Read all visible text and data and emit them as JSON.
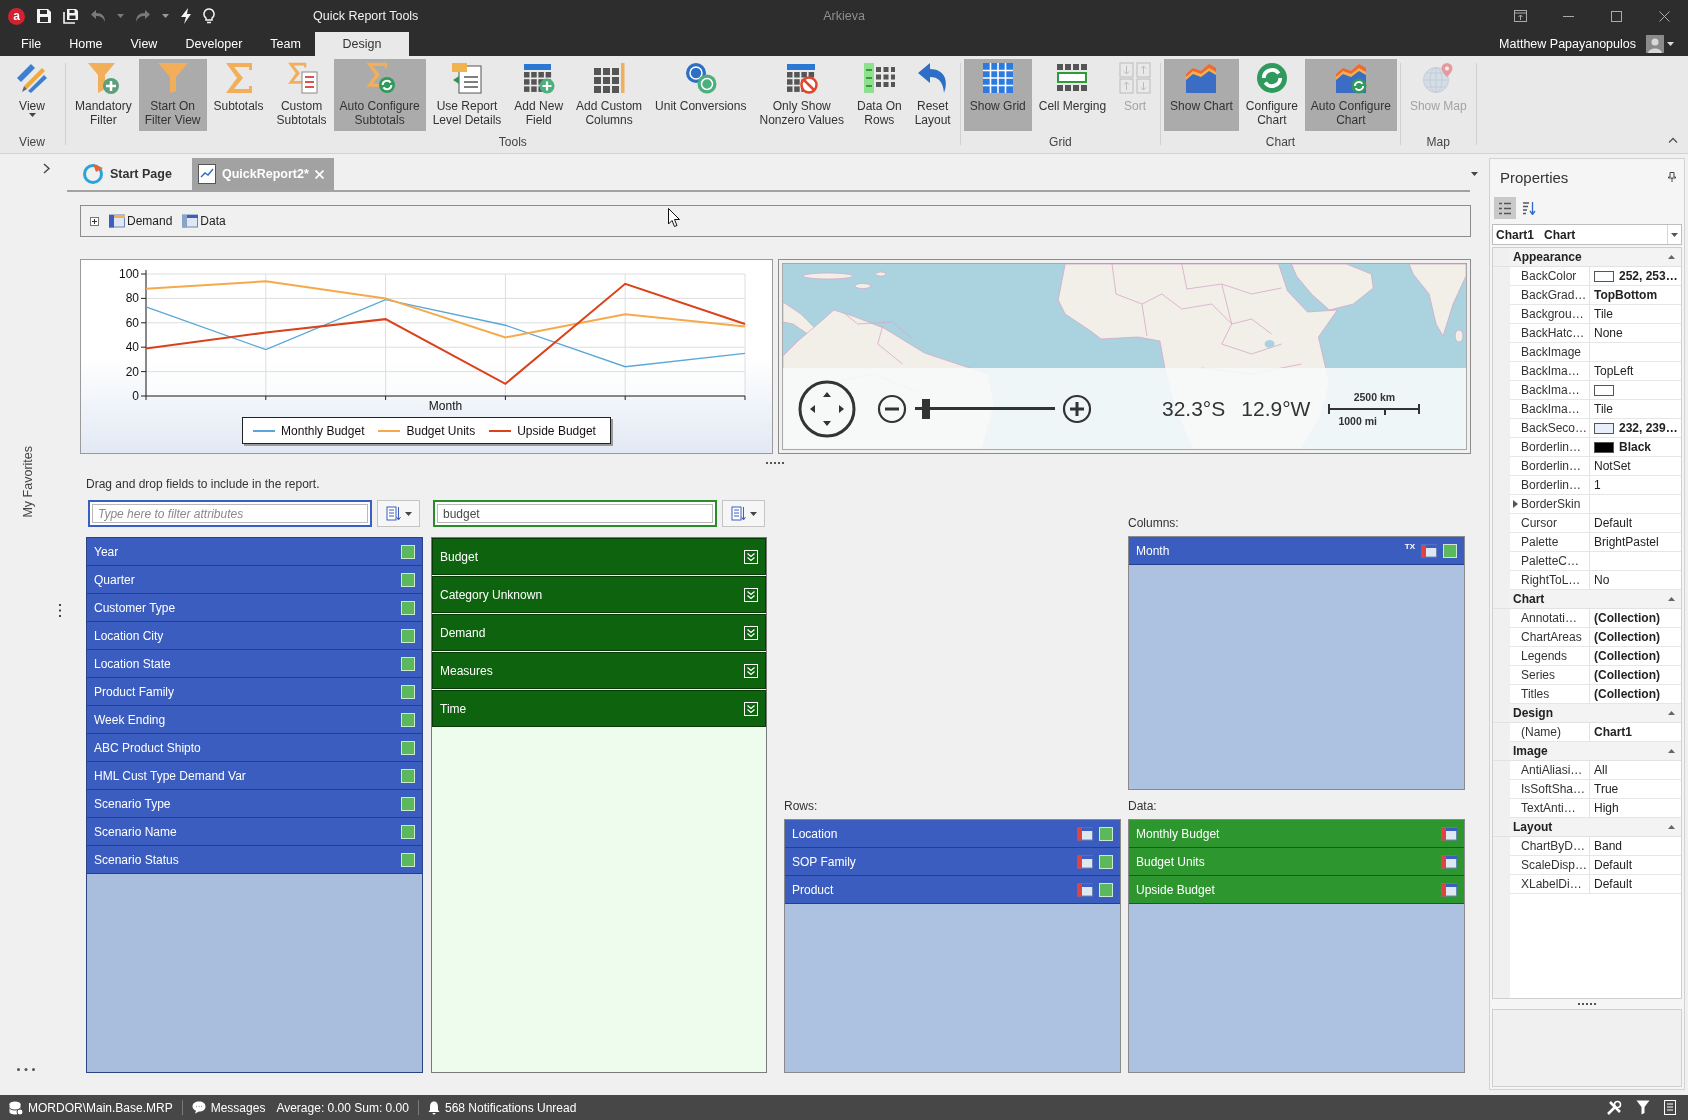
{
  "title_bar": {
    "logo": "a",
    "context_title": "Quick Report Tools",
    "app_title": "Arkieva"
  },
  "menu_tabs": [
    {
      "label": "File",
      "selected": false
    },
    {
      "label": "Home",
      "selected": false
    },
    {
      "label": "View",
      "selected": false
    },
    {
      "label": "Developer",
      "selected": false
    },
    {
      "label": "Team",
      "selected": false
    },
    {
      "label": "Design",
      "selected": true
    }
  ],
  "user": {
    "name": "Matthew Papayanopulos"
  },
  "ribbon": {
    "groups": [
      {
        "label": "View",
        "buttons": [
          {
            "label": "View",
            "pressed": false,
            "disabled": false,
            "dropdown": true
          }
        ]
      },
      {
        "label": "Tools",
        "buttons": [
          {
            "label": "Mandatory\nFilter",
            "pressed": false,
            "disabled": false,
            "dropdown": false
          },
          {
            "label": "Start On\nFilter View",
            "pressed": true,
            "disabled": false,
            "dropdown": false
          },
          {
            "label": "Subtotals",
            "pressed": false,
            "disabled": false,
            "dropdown": false
          },
          {
            "label": "Custom\nSubtotals",
            "pressed": false,
            "disabled": false,
            "dropdown": false
          },
          {
            "label": "Auto Configure\nSubtotals",
            "pressed": true,
            "disabled": false,
            "dropdown": false
          },
          {
            "label": "Use Report\nLevel Details",
            "pressed": false,
            "disabled": false,
            "dropdown": false
          },
          {
            "label": "Add New\nField",
            "pressed": false,
            "disabled": false,
            "dropdown": false
          },
          {
            "label": "Add Custom\nColumns",
            "pressed": false,
            "disabled": false,
            "dropdown": false
          },
          {
            "label": "Unit Conversions",
            "pressed": false,
            "disabled": false,
            "dropdown": false
          },
          {
            "label": "Only Show\nNonzero Values",
            "pressed": false,
            "disabled": false,
            "dropdown": false
          },
          {
            "label": "Data On\nRows",
            "pressed": false,
            "disabled": false,
            "dropdown": false
          },
          {
            "label": "Reset\nLayout",
            "pressed": false,
            "disabled": false,
            "dropdown": false
          }
        ]
      },
      {
        "label": "Grid",
        "buttons": [
          {
            "label": "Show Grid",
            "pressed": true,
            "disabled": false,
            "dropdown": false
          },
          {
            "label": "Cell Merging",
            "pressed": false,
            "disabled": false,
            "dropdown": false
          },
          {
            "label": "Sort",
            "pressed": false,
            "disabled": true,
            "dropdown": false
          }
        ]
      },
      {
        "label": "Chart",
        "buttons": [
          {
            "label": "Show Chart",
            "pressed": true,
            "disabled": false,
            "dropdown": false
          },
          {
            "label": "Configure\nChart",
            "pressed": false,
            "disabled": false,
            "dropdown": false
          },
          {
            "label": "Auto Configure\nChart",
            "pressed": true,
            "disabled": false,
            "dropdown": false
          }
        ]
      },
      {
        "label": "Map",
        "buttons": [
          {
            "label": "Show Map",
            "pressed": false,
            "disabled": true,
            "dropdown": false
          }
        ]
      }
    ]
  },
  "sidebar": {
    "label": "My Favorites"
  },
  "document_tabs": [
    {
      "label": "Start Page",
      "selected": false,
      "closable": false
    },
    {
      "label": "QuickReport2*",
      "selected": true,
      "closable": true
    }
  ],
  "breadcrumb": {
    "items": [
      {
        "label": "Demand"
      },
      {
        "label": "Data"
      }
    ]
  },
  "chart": {
    "chart_data": {
      "type": "line",
      "xlabel": "Month",
      "ylim": [
        0,
        100
      ],
      "yticks": [
        0,
        20,
        40,
        60,
        80,
        100
      ],
      "grid": true,
      "legend": "bottom",
      "series": [
        {
          "name": "Monthly Budget",
          "color": "#5aa6d6",
          "values": [
            73,
            38,
            79,
            58,
            24,
            35
          ]
        },
        {
          "name": "Budget Units",
          "color": "#f5a94b",
          "values": [
            88,
            94,
            80,
            48,
            67,
            57
          ]
        },
        {
          "name": "Upside Budget",
          "color": "#d9421a",
          "values": [
            39,
            52,
            63,
            10,
            92,
            59
          ]
        }
      ]
    }
  },
  "map": {
    "latitude": "32.3°S",
    "longitude": "12.9°W",
    "scale_km": "2500 km",
    "scale_mi": "1000 mi",
    "zoom": {
      "level": 0.05
    }
  },
  "field_picker": {
    "hint": "Drag and drop fields to include in the report.",
    "attributes": {
      "filter": {
        "placeholder": "Type here to filter attributes"
      },
      "items": [
        "Year",
        "Quarter",
        "Customer Type",
        "Location City",
        "Location State",
        "Product Family",
        "Week Ending",
        "ABC Product Shipto",
        "HML Cust Type Demand Var",
        "Scenario Type",
        "Scenario Name",
        "Scenario Status"
      ]
    },
    "measures": {
      "filter": {
        "value": "budget"
      },
      "items": [
        "Budget",
        "Category Unknown",
        "Demand",
        "Measures",
        "Time"
      ]
    },
    "columns": {
      "label": "Columns:",
      "items": [
        {
          "label": "Month",
          "badge": "TX"
        }
      ]
    },
    "rows": {
      "label": "Rows:",
      "items": [
        {
          "label": "Location"
        },
        {
          "label": "SOP Family"
        },
        {
          "label": "Product"
        }
      ]
    },
    "data": {
      "label": "Data:",
      "items": [
        {
          "label": "Monthly Budget"
        },
        {
          "label": "Budget Units"
        },
        {
          "label": "Upside Budget"
        }
      ]
    }
  },
  "properties": {
    "title": "Properties",
    "view_modes": [
      {
        "selected": true
      },
      {
        "selected": false
      }
    ],
    "selector": {
      "name": "Chart1",
      "type": "Chart"
    },
    "categories": [
      {
        "label": "Appearance",
        "expanded": true,
        "rows": [
          {
            "name": "BackColor",
            "value": "252, 253…",
            "color": "#fcfdff",
            "bold": true,
            "expandable": false
          },
          {
            "name": "BackGrad…",
            "value": "TopBottom",
            "bold": true,
            "expandable": false
          },
          {
            "name": "Backgrou…",
            "value": "Tile",
            "bold": false,
            "expandable": false
          },
          {
            "name": "BackHatc…",
            "value": "None",
            "bold": false,
            "expandable": false
          },
          {
            "name": "BackImage",
            "expandable": false
          },
          {
            "name": "BackIma…",
            "value": "TopLeft",
            "bold": false,
            "expandable": false
          },
          {
            "name": "BackIma…",
            "color": "#ffffff",
            "expandable": false
          },
          {
            "name": "BackIma…",
            "value": "Tile",
            "bold": false,
            "expandable": false
          },
          {
            "name": "BackSeco…",
            "value": "232, 239…",
            "color": "#e8effa",
            "bold": true,
            "expandable": false
          },
          {
            "name": "Borderlin…",
            "value": "Black",
            "color": "#000000",
            "bold": true,
            "expandable": false
          },
          {
            "name": "Borderlin…",
            "value": "NotSet",
            "bold": false,
            "expandable": false
          },
          {
            "name": "Borderlin…",
            "value": "1",
            "bold": false,
            "expandable": false
          },
          {
            "name": "BorderSkin",
            "expandable": true
          },
          {
            "name": "Cursor",
            "value": "Default",
            "bold": false,
            "expandable": false
          },
          {
            "name": "Palette",
            "value": "BrightPastel",
            "bold": false,
            "expandable": false
          },
          {
            "name": "PaletteC…",
            "expandable": false
          },
          {
            "name": "RightToL…",
            "value": "No",
            "bold": false,
            "expandable": false
          }
        ]
      },
      {
        "label": "Chart",
        "expanded": true,
        "rows": [
          {
            "name": "Annotati…",
            "value": "(Collection)",
            "bold": true,
            "expandable": false
          },
          {
            "name": "ChartAreas",
            "value": "(Collection)",
            "bold": true,
            "expandable": false
          },
          {
            "name": "Legends",
            "value": "(Collection)",
            "bold": true,
            "expandable": false
          },
          {
            "name": "Series",
            "value": "(Collection)",
            "bold": true,
            "expandable": false
          },
          {
            "name": "Titles",
            "value": "(Collection)",
            "bold": true,
            "expandable": false
          }
        ]
      },
      {
        "label": "Design",
        "expanded": true,
        "rows": [
          {
            "name": "(Name)",
            "value": "Chart1",
            "bold": true,
            "expandable": false
          }
        ]
      },
      {
        "label": "Image",
        "expanded": true,
        "rows": [
          {
            "name": "AntiAliasi…",
            "value": "All",
            "bold": false,
            "expandable": false
          },
          {
            "name": "IsSoftSha…",
            "value": "True",
            "bold": false,
            "expandable": false
          },
          {
            "name": "TextAnti…",
            "value": "High",
            "bold": false,
            "expandable": false
          }
        ]
      },
      {
        "label": "Layout",
        "expanded": true,
        "rows": [
          {
            "name": "ChartByD…",
            "value": "Band",
            "bold": false,
            "expandable": false
          },
          {
            "name": "ScaleDisp…",
            "value": "Default",
            "bold": false,
            "expandable": false
          },
          {
            "name": "XLabelDi…",
            "value": "Default",
            "bold": false,
            "expandable": false
          }
        ]
      }
    ]
  },
  "status_bar": {
    "database": "MORDOR\\Main.Base.MRP",
    "messages": "Messages",
    "summary": "Average: 0.00 Sum: 0.00",
    "notifications": "568 Notifications Unread"
  }
}
